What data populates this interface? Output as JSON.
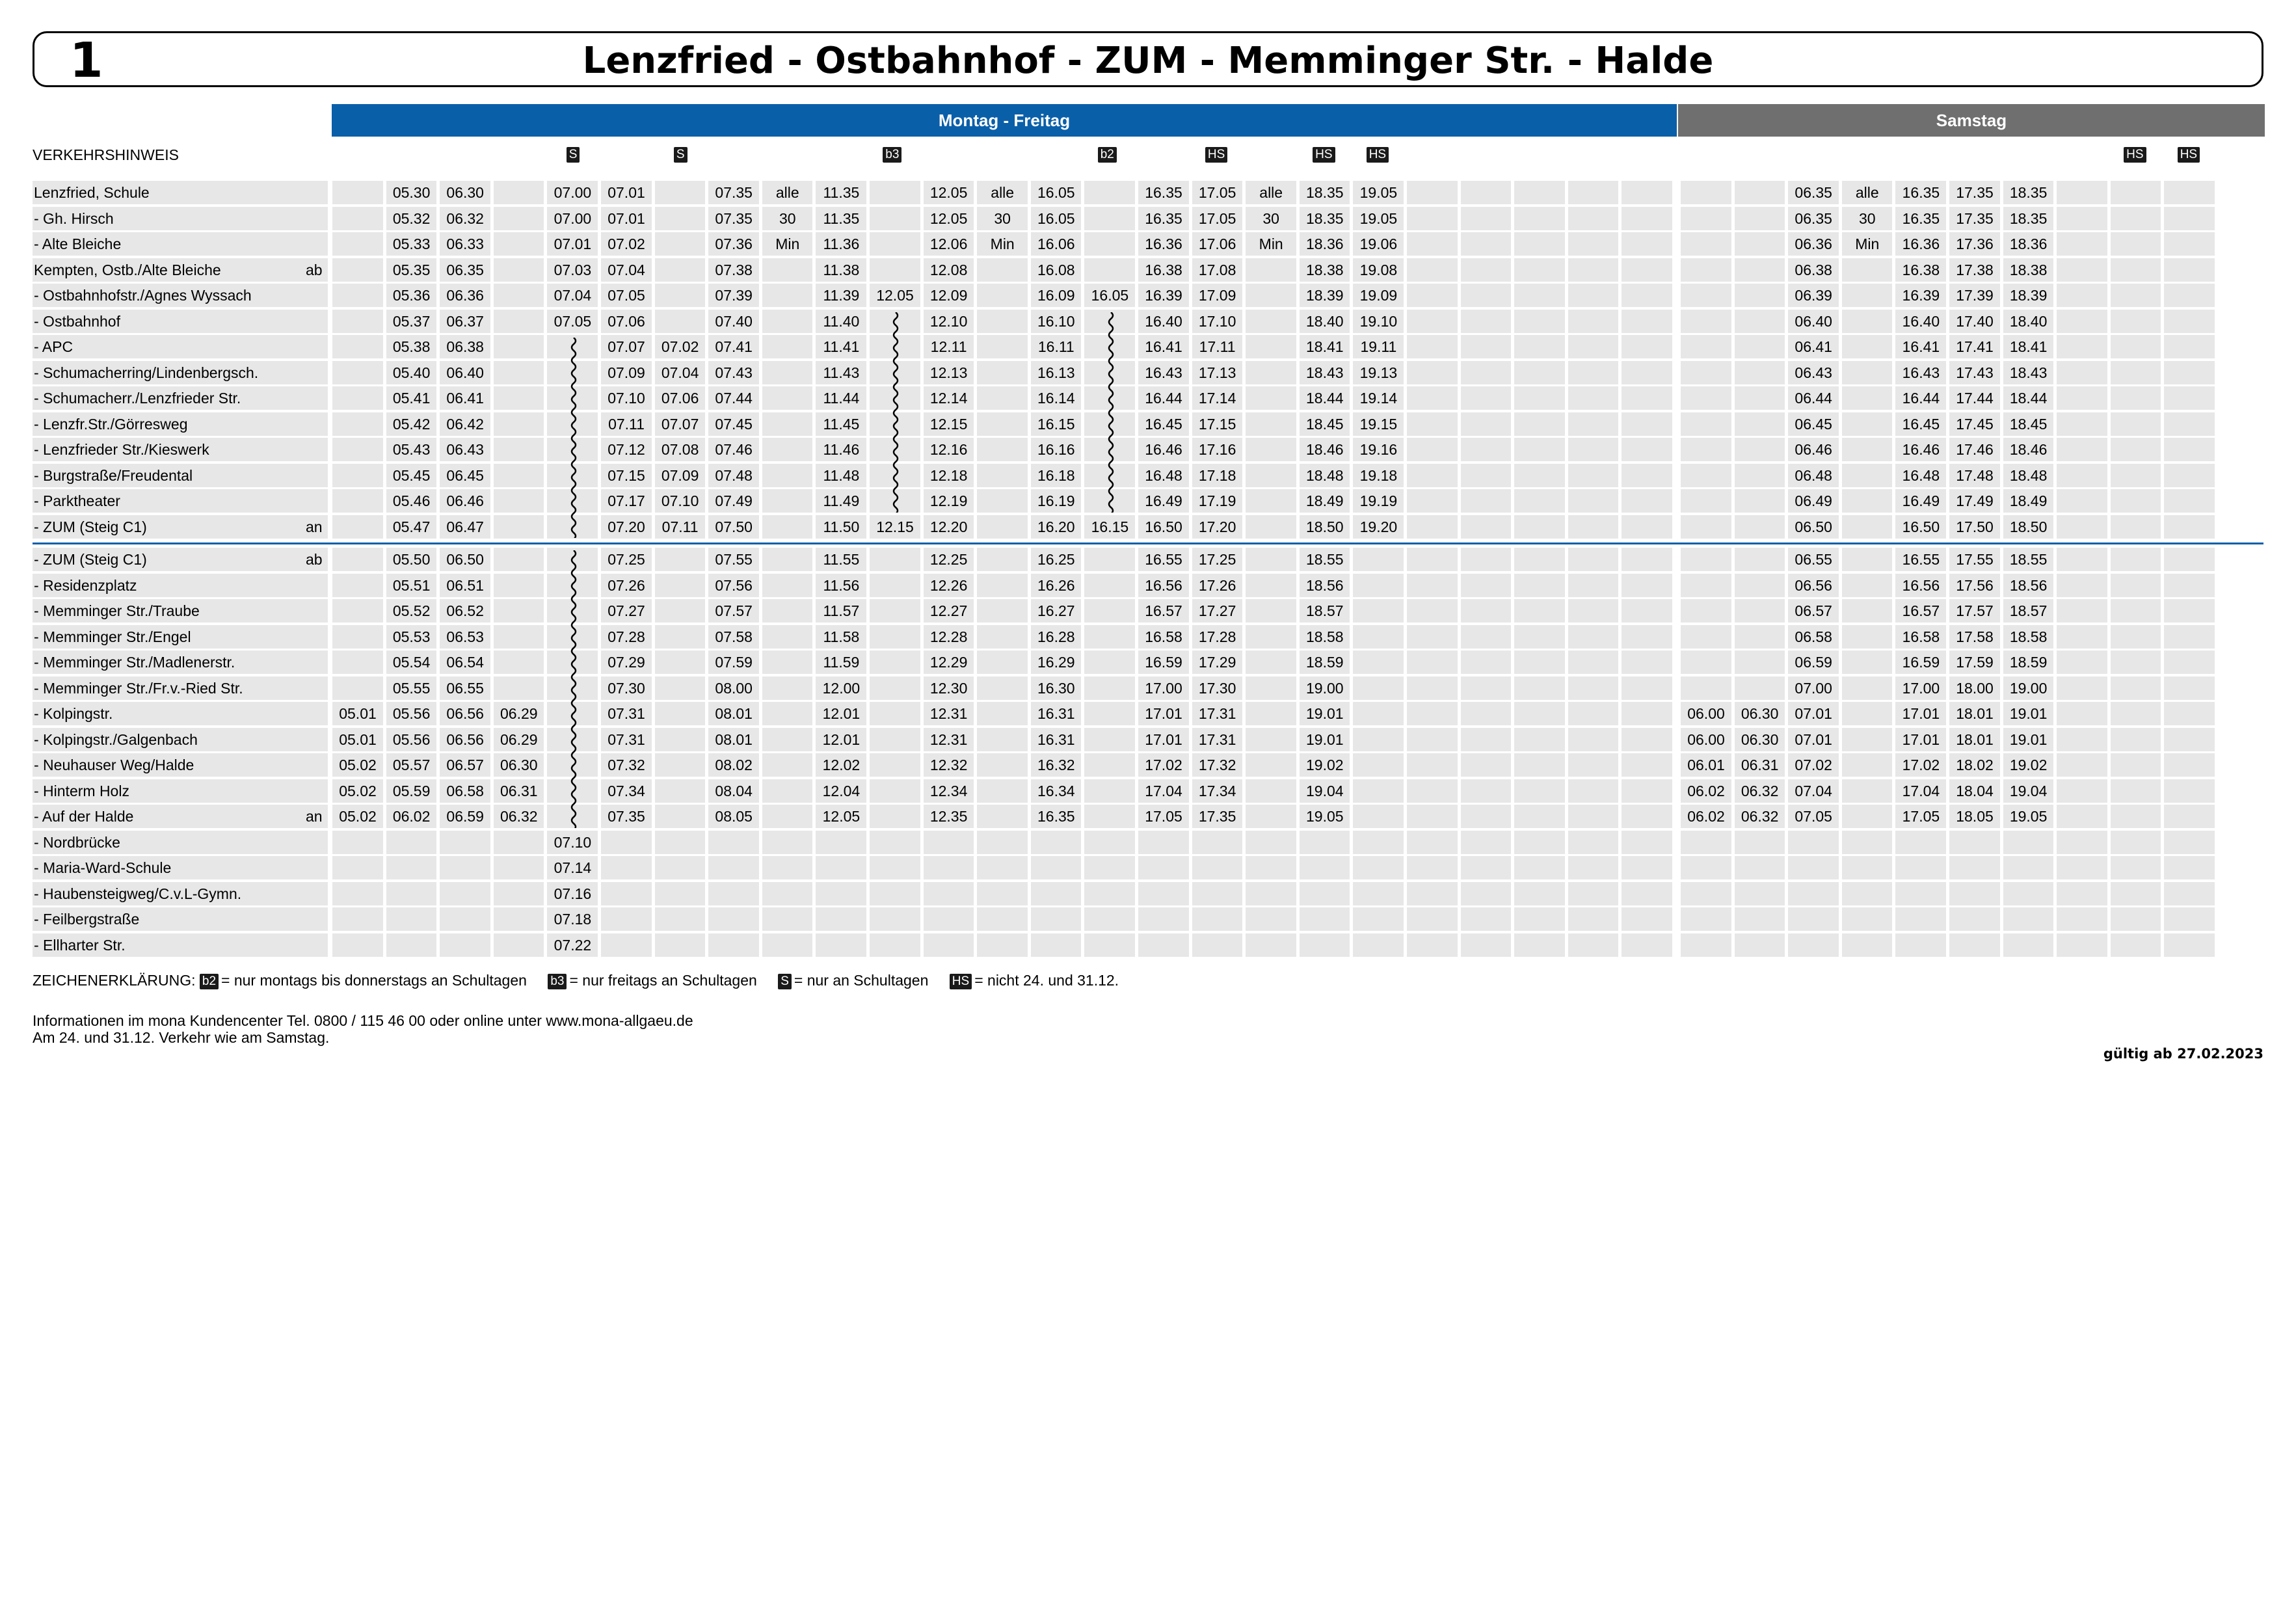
{
  "header": {
    "line_number": "1",
    "route_title": "Lenzfried - Ostbahnhof - ZUM - Memminger Str. - Halde",
    "back_icon": "arrow-left-icon"
  },
  "service_bands": {
    "weekday": "Montag - Freitag",
    "saturday": "Samstag"
  },
  "traffic_note_label": "VERKEHRSHINWEIS",
  "columns": {
    "weekday_count": 25,
    "saturday_count": 10,
    "badges": [
      {
        "col": 4,
        "text": "S"
      },
      {
        "col": 6,
        "text": "S"
      },
      {
        "col": 10,
        "text": "b3"
      },
      {
        "col": 14,
        "text": "b2"
      },
      {
        "col": 16,
        "text": "HS"
      },
      {
        "col": 18,
        "text": "HS"
      },
      {
        "col": 19,
        "text": "HS"
      },
      {
        "col": 33,
        "text": "HS"
      },
      {
        "col": 34,
        "text": "HS"
      }
    ]
  },
  "section1": [
    {
      "stop": "Lenzfried, Schule",
      "flag": "",
      "times": [
        "",
        "05.30",
        "06.30",
        "",
        "07.00",
        "07.01",
        "",
        "07.35",
        "alle",
        "11.35",
        "",
        "12.05",
        "alle",
        "16.05",
        "",
        "16.35",
        "17.05",
        "alle",
        "18.35",
        "19.05",
        "",
        "",
        "",
        "",
        "",
        "",
        "",
        "06.35",
        "alle",
        "16.35",
        "17.35",
        "18.35",
        "",
        "",
        ""
      ]
    },
    {
      "stop": "- Gh. Hirsch",
      "flag": "",
      "times": [
        "",
        "05.32",
        "06.32",
        "",
        "07.00",
        "07.01",
        "",
        "07.35",
        "30",
        "11.35",
        "",
        "12.05",
        "30",
        "16.05",
        "",
        "16.35",
        "17.05",
        "30",
        "18.35",
        "19.05",
        "",
        "",
        "",
        "",
        "",
        "",
        "",
        "06.35",
        "30",
        "16.35",
        "17.35",
        "18.35",
        "",
        "",
        ""
      ]
    },
    {
      "stop": "- Alte Bleiche",
      "flag": "",
      "times": [
        "",
        "05.33",
        "06.33",
        "",
        "07.01",
        "07.02",
        "",
        "07.36",
        "Min",
        "11.36",
        "",
        "12.06",
        "Min",
        "16.06",
        "",
        "16.36",
        "17.06",
        "Min",
        "18.36",
        "19.06",
        "",
        "",
        "",
        "",
        "",
        "",
        "",
        "06.36",
        "Min",
        "16.36",
        "17.36",
        "18.36",
        "",
        "",
        ""
      ]
    },
    {
      "stop": "Kempten, Ostb./Alte Bleiche",
      "flag": "ab",
      "times": [
        "",
        "05.35",
        "06.35",
        "",
        "07.03",
        "07.04",
        "",
        "07.38",
        "",
        "11.38",
        "",
        "12.08",
        "",
        "16.08",
        "",
        "16.38",
        "17.08",
        "",
        "18.38",
        "19.08",
        "",
        "",
        "",
        "",
        "",
        "",
        "",
        "06.38",
        "",
        "16.38",
        "17.38",
        "18.38",
        "",
        "",
        ""
      ]
    },
    {
      "stop": "- Ostbahnhofstr./Agnes Wyssach",
      "flag": "",
      "times": [
        "",
        "05.36",
        "06.36",
        "",
        "07.04",
        "07.05",
        "",
        "07.39",
        "",
        "11.39",
        "12.05",
        "12.09",
        "",
        "16.09",
        "16.05",
        "16.39",
        "17.09",
        "",
        "18.39",
        "19.09",
        "",
        "",
        "",
        "",
        "",
        "",
        "",
        "06.39",
        "",
        "16.39",
        "17.39",
        "18.39",
        "",
        "",
        ""
      ]
    },
    {
      "stop": "- Ostbahnhof",
      "flag": "",
      "times": [
        "",
        "05.37",
        "06.37",
        "",
        "07.05",
        "07.06",
        "",
        "07.40",
        "",
        "11.40",
        "",
        "12.10",
        "",
        "16.10",
        "",
        "16.40",
        "17.10",
        "",
        "18.40",
        "19.10",
        "",
        "",
        "",
        "",
        "",
        "",
        "",
        "06.40",
        "",
        "16.40",
        "17.40",
        "18.40",
        "",
        "",
        ""
      ]
    },
    {
      "stop": "- APC",
      "flag": "",
      "times": [
        "",
        "05.38",
        "06.38",
        "",
        "",
        "07.07",
        "07.02",
        "07.41",
        "",
        "11.41",
        "",
        "12.11",
        "",
        "16.11",
        "",
        "16.41",
        "17.11",
        "",
        "18.41",
        "19.11",
        "",
        "",
        "",
        "",
        "",
        "",
        "",
        "06.41",
        "",
        "16.41",
        "17.41",
        "18.41",
        "",
        "",
        ""
      ]
    },
    {
      "stop": "- Schumacherring/Lindenbergsch.",
      "flag": "",
      "times": [
        "",
        "05.40",
        "06.40",
        "",
        "",
        "07.09",
        "07.04",
        "07.43",
        "",
        "11.43",
        "",
        "12.13",
        "",
        "16.13",
        "",
        "16.43",
        "17.13",
        "",
        "18.43",
        "19.13",
        "",
        "",
        "",
        "",
        "",
        "",
        "",
        "06.43",
        "",
        "16.43",
        "17.43",
        "18.43",
        "",
        "",
        ""
      ]
    },
    {
      "stop": "- Schumacherr./Lenzfrieder Str.",
      "flag": "",
      "times": [
        "",
        "05.41",
        "06.41",
        "",
        "",
        "07.10",
        "07.06",
        "07.44",
        "",
        "11.44",
        "",
        "12.14",
        "",
        "16.14",
        "",
        "16.44",
        "17.14",
        "",
        "18.44",
        "19.14",
        "",
        "",
        "",
        "",
        "",
        "",
        "",
        "06.44",
        "",
        "16.44",
        "17.44",
        "18.44",
        "",
        "",
        ""
      ]
    },
    {
      "stop": "- Lenzfr.Str./Görresweg",
      "flag": "",
      "times": [
        "",
        "05.42",
        "06.42",
        "",
        "",
        "07.11",
        "07.07",
        "07.45",
        "",
        "11.45",
        "",
        "12.15",
        "",
        "16.15",
        "",
        "16.45",
        "17.15",
        "",
        "18.45",
        "19.15",
        "",
        "",
        "",
        "",
        "",
        "",
        "",
        "06.45",
        "",
        "16.45",
        "17.45",
        "18.45",
        "",
        "",
        ""
      ]
    },
    {
      "stop": "- Lenzfrieder Str./Kieswerk",
      "flag": "",
      "times": [
        "",
        "05.43",
        "06.43",
        "",
        "",
        "07.12",
        "07.08",
        "07.46",
        "",
        "11.46",
        "",
        "12.16",
        "",
        "16.16",
        "",
        "16.46",
        "17.16",
        "",
        "18.46",
        "19.16",
        "",
        "",
        "",
        "",
        "",
        "",
        "",
        "06.46",
        "",
        "16.46",
        "17.46",
        "18.46",
        "",
        "",
        ""
      ]
    },
    {
      "stop": "- Burgstraße/Freudental",
      "flag": "",
      "times": [
        "",
        "05.45",
        "06.45",
        "",
        "",
        "07.15",
        "07.09",
        "07.48",
        "",
        "11.48",
        "",
        "12.18",
        "",
        "16.18",
        "",
        "16.48",
        "17.18",
        "",
        "18.48",
        "19.18",
        "",
        "",
        "",
        "",
        "",
        "",
        "",
        "06.48",
        "",
        "16.48",
        "17.48",
        "18.48",
        "",
        "",
        ""
      ]
    },
    {
      "stop": "- Parktheater",
      "flag": "",
      "times": [
        "",
        "05.46",
        "06.46",
        "",
        "",
        "07.17",
        "07.10",
        "07.49",
        "",
        "11.49",
        "",
        "12.19",
        "",
        "16.19",
        "",
        "16.49",
        "17.19",
        "",
        "18.49",
        "19.19",
        "",
        "",
        "",
        "",
        "",
        "",
        "",
        "06.49",
        "",
        "16.49",
        "17.49",
        "18.49",
        "",
        "",
        ""
      ]
    },
    {
      "stop": "- ZUM (Steig C1)",
      "flag": "an",
      "times": [
        "",
        "05.47",
        "06.47",
        "",
        "",
        "07.20",
        "07.11",
        "07.50",
        "",
        "11.50",
        "12.15",
        "12.20",
        "",
        "16.20",
        "16.15",
        "16.50",
        "17.20",
        "",
        "18.50",
        "19.20",
        "",
        "",
        "",
        "",
        "",
        "",
        "",
        "06.50",
        "",
        "16.50",
        "17.50",
        "18.50",
        "",
        "",
        ""
      ]
    }
  ],
  "section2": [
    {
      "stop": "- ZUM (Steig C1)",
      "flag": "ab",
      "times": [
        "",
        "05.50",
        "06.50",
        "",
        "",
        "07.25",
        "",
        "07.55",
        "",
        "11.55",
        "",
        "12.25",
        "",
        "16.25",
        "",
        "16.55",
        "17.25",
        "",
        "18.55",
        "",
        "",
        "",
        "",
        "",
        "",
        "",
        "",
        "06.55",
        "",
        "16.55",
        "17.55",
        "18.55",
        "",
        "",
        ""
      ]
    },
    {
      "stop": "- Residenzplatz",
      "flag": "",
      "times": [
        "",
        "05.51",
        "06.51",
        "",
        "",
        "07.26",
        "",
        "07.56",
        "",
        "11.56",
        "",
        "12.26",
        "",
        "16.26",
        "",
        "16.56",
        "17.26",
        "",
        "18.56",
        "",
        "",
        "",
        "",
        "",
        "",
        "",
        "",
        "06.56",
        "",
        "16.56",
        "17.56",
        "18.56",
        "",
        "",
        ""
      ]
    },
    {
      "stop": "- Memminger Str./Traube",
      "flag": "",
      "times": [
        "",
        "05.52",
        "06.52",
        "",
        "",
        "07.27",
        "",
        "07.57",
        "",
        "11.57",
        "",
        "12.27",
        "",
        "16.27",
        "",
        "16.57",
        "17.27",
        "",
        "18.57",
        "",
        "",
        "",
        "",
        "",
        "",
        "",
        "",
        "06.57",
        "",
        "16.57",
        "17.57",
        "18.57",
        "",
        "",
        ""
      ]
    },
    {
      "stop": "- Memminger Str./Engel",
      "flag": "",
      "times": [
        "",
        "05.53",
        "06.53",
        "",
        "",
        "07.28",
        "",
        "07.58",
        "",
        "11.58",
        "",
        "12.28",
        "",
        "16.28",
        "",
        "16.58",
        "17.28",
        "",
        "18.58",
        "",
        "",
        "",
        "",
        "",
        "",
        "",
        "",
        "06.58",
        "",
        "16.58",
        "17.58",
        "18.58",
        "",
        "",
        ""
      ]
    },
    {
      "stop": "- Memminger Str./Madlenerstr.",
      "flag": "",
      "times": [
        "",
        "05.54",
        "06.54",
        "",
        "",
        "07.29",
        "",
        "07.59",
        "",
        "11.59",
        "",
        "12.29",
        "",
        "16.29",
        "",
        "16.59",
        "17.29",
        "",
        "18.59",
        "",
        "",
        "",
        "",
        "",
        "",
        "",
        "",
        "06.59",
        "",
        "16.59",
        "17.59",
        "18.59",
        "",
        "",
        ""
      ]
    },
    {
      "stop": "- Memminger Str./Fr.v.-Ried Str.",
      "flag": "",
      "times": [
        "",
        "05.55",
        "06.55",
        "",
        "",
        "07.30",
        "",
        "08.00",
        "",
        "12.00",
        "",
        "12.30",
        "",
        "16.30",
        "",
        "17.00",
        "17.30",
        "",
        "19.00",
        "",
        "",
        "",
        "",
        "",
        "",
        "",
        "",
        "07.00",
        "",
        "17.00",
        "18.00",
        "19.00",
        "",
        "",
        ""
      ]
    },
    {
      "stop": "- Kolpingstr.",
      "flag": "",
      "times": [
        "05.01",
        "05.56",
        "06.56",
        "06.29",
        "",
        "07.31",
        "",
        "08.01",
        "",
        "12.01",
        "",
        "12.31",
        "",
        "16.31",
        "",
        "17.01",
        "17.31",
        "",
        "19.01",
        "",
        "",
        "",
        "",
        "",
        "",
        "06.00",
        "06.30",
        "07.01",
        "",
        "17.01",
        "18.01",
        "19.01",
        "",
        "",
        ""
      ]
    },
    {
      "stop": "- Kolpingstr./Galgenbach",
      "flag": "",
      "times": [
        "05.01",
        "05.56",
        "06.56",
        "06.29",
        "",
        "07.31",
        "",
        "08.01",
        "",
        "12.01",
        "",
        "12.31",
        "",
        "16.31",
        "",
        "17.01",
        "17.31",
        "",
        "19.01",
        "",
        "",
        "",
        "",
        "",
        "",
        "06.00",
        "06.30",
        "07.01",
        "",
        "17.01",
        "18.01",
        "19.01",
        "",
        "",
        ""
      ]
    },
    {
      "stop": "- Neuhauser Weg/Halde",
      "flag": "",
      "times": [
        "05.02",
        "05.57",
        "06.57",
        "06.30",
        "",
        "07.32",
        "",
        "08.02",
        "",
        "12.02",
        "",
        "12.32",
        "",
        "16.32",
        "",
        "17.02",
        "17.32",
        "",
        "19.02",
        "",
        "",
        "",
        "",
        "",
        "",
        "06.01",
        "06.31",
        "07.02",
        "",
        "17.02",
        "18.02",
        "19.02",
        "",
        "",
        ""
      ]
    },
    {
      "stop": "- Hinterm Holz",
      "flag": "",
      "times": [
        "05.02",
        "05.59",
        "06.58",
        "06.31",
        "",
        "07.34",
        "",
        "08.04",
        "",
        "12.04",
        "",
        "12.34",
        "",
        "16.34",
        "",
        "17.04",
        "17.34",
        "",
        "19.04",
        "",
        "",
        "",
        "",
        "",
        "",
        "06.02",
        "06.32",
        "07.04",
        "",
        "17.04",
        "18.04",
        "19.04",
        "",
        "",
        ""
      ]
    },
    {
      "stop": "- Auf der Halde",
      "flag": "an",
      "times": [
        "05.02",
        "06.02",
        "06.59",
        "06.32",
        "",
        "07.35",
        "",
        "08.05",
        "",
        "12.05",
        "",
        "12.35",
        "",
        "16.35",
        "",
        "17.05",
        "17.35",
        "",
        "19.05",
        "",
        "",
        "",
        "",
        "",
        "",
        "06.02",
        "06.32",
        "07.05",
        "",
        "17.05",
        "18.05",
        "19.05",
        "",
        "",
        ""
      ]
    },
    {
      "stop": "- Nordbrücke",
      "flag": "",
      "times": [
        "",
        "",
        "",
        "",
        "07.10",
        "",
        "",
        "",
        "",
        "",
        "",
        "",
        "",
        "",
        "",
        "",
        "",
        "",
        "",
        "",
        "",
        "",
        "",
        "",
        "",
        "",
        "",
        "",
        "",
        "",
        "",
        "",
        "",
        "",
        ""
      ]
    },
    {
      "stop": "- Maria-Ward-Schule",
      "flag": "",
      "times": [
        "",
        "",
        "",
        "",
        "07.14",
        "",
        "",
        "",
        "",
        "",
        "",
        "",
        "",
        "",
        "",
        "",
        "",
        "",
        "",
        "",
        "",
        "",
        "",
        "",
        "",
        "",
        "",
        "",
        "",
        "",
        "",
        "",
        "",
        "",
        ""
      ]
    },
    {
      "stop": "- Haubensteigweg/C.v.L-Gymn.",
      "flag": "",
      "times": [
        "",
        "",
        "",
        "",
        "07.16",
        "",
        "",
        "",
        "",
        "",
        "",
        "",
        "",
        "",
        "",
        "",
        "",
        "",
        "",
        "",
        "",
        "",
        "",
        "",
        "",
        "",
        "",
        "",
        "",
        "",
        "",
        "",
        "",
        "",
        ""
      ]
    },
    {
      "stop": "- Feilbergstraße",
      "flag": "",
      "times": [
        "",
        "",
        "",
        "",
        "07.18",
        "",
        "",
        "",
        "",
        "",
        "",
        "",
        "",
        "",
        "",
        "",
        "",
        "",
        "",
        "",
        "",
        "",
        "",
        "",
        "",
        "",
        "",
        "",
        "",
        "",
        "",
        "",
        "",
        "",
        ""
      ]
    },
    {
      "stop": "- Ellharter Str.",
      "flag": "",
      "times": [
        "",
        "",
        "",
        "",
        "07.22",
        "",
        "",
        "",
        "",
        "",
        "",
        "",
        "",
        "",
        "",
        "",
        "",
        "",
        "",
        "",
        "",
        "",
        "",
        "",
        "",
        "",
        "",
        "",
        "",
        "",
        "",
        "",
        "",
        "",
        ""
      ]
    }
  ],
  "wavy_markers": {
    "section1": [
      {
        "col": 4,
        "from_row": 6,
        "to_row": 13
      },
      {
        "col": 10,
        "from_row": 5,
        "to_row": 12
      },
      {
        "col": 14,
        "from_row": 5,
        "to_row": 12
      }
    ],
    "section2": [
      {
        "col": 4,
        "from_row": 0,
        "to_row": 10
      }
    ]
  },
  "legend": {
    "prefix": "ZEICHENERKLÄRUNG:",
    "items": [
      {
        "badge": "b2",
        "text": "= nur montags bis donnerstags an Schultagen"
      },
      {
        "badge": "b3",
        "text": "= nur freitags an Schultagen"
      },
      {
        "badge": "S",
        "text": "= nur an Schultagen"
      },
      {
        "badge": "HS",
        "text": "= nicht 24. und 31.12."
      }
    ]
  },
  "info": {
    "line1": "Informationen im mona Kundencenter Tel. 0800 / 115 46 00 oder online unter www.mona-allgaeu.de",
    "line2": "Am 24. und 31.12. Verkehr wie am Samstag."
  },
  "valid_from": "gültig ab 27.02.2023",
  "colors": {
    "weekday_band": "#0a5fa9",
    "saturday_band": "#6f6f6f",
    "stripe": "#e7e7e7",
    "badge": "#1a1a1a"
  }
}
